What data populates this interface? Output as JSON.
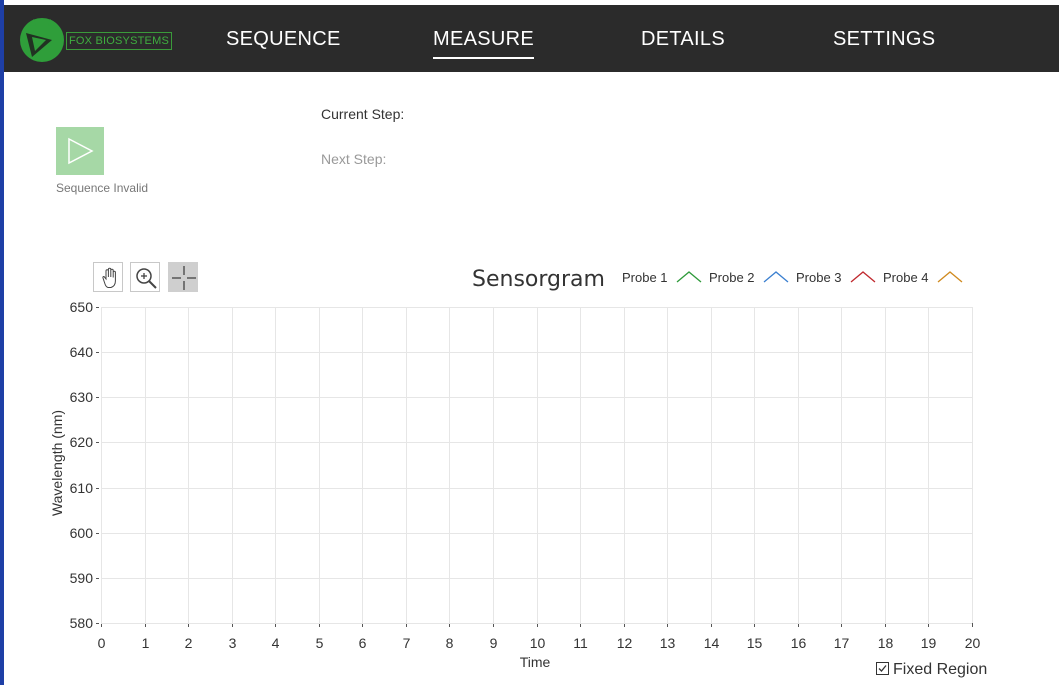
{
  "app": {
    "brand": "FOX BIOSYSTEMS"
  },
  "nav": {
    "tabs": [
      {
        "label": "SEQUENCE",
        "active": false
      },
      {
        "label": "MEASURE",
        "active": true
      },
      {
        "label": "DETAILS",
        "active": false
      },
      {
        "label": "SETTINGS",
        "active": false
      }
    ]
  },
  "controls": {
    "play_icon": "play-icon",
    "sequence_status": "Sequence Invalid",
    "current_step_label": "Current Step:",
    "next_step_label": "Next Step:"
  },
  "toolbar": {
    "tools": [
      {
        "name": "pan",
        "icon": "hand-icon",
        "active": false
      },
      {
        "name": "zoom",
        "icon": "zoom-in-icon",
        "active": false
      },
      {
        "name": "crosshair",
        "icon": "crosshair-icon",
        "active": true
      }
    ]
  },
  "fixed_region": {
    "label": "Fixed Region",
    "checked": true
  },
  "colors": {
    "nav_bg": "#2b2b2b",
    "brand_green": "#3fae3f",
    "play_button": "#a6d8a6",
    "probe1": "#2e9a3a",
    "probe2": "#3a7fd0",
    "probe3": "#c0282d",
    "probe4": "#d08a1e"
  },
  "chart_data": {
    "type": "line",
    "title": "Sensorgram",
    "xlabel": "Time",
    "ylabel": "Wavelength (nm)",
    "xlim": [
      0,
      20
    ],
    "ylim": [
      580,
      650
    ],
    "x_ticks": [
      "0",
      "1",
      "2",
      "3",
      "4",
      "5",
      "6",
      "7",
      "8",
      "9",
      "10",
      "11",
      "12",
      "13",
      "14",
      "15",
      "16",
      "17",
      "18",
      "19",
      "20"
    ],
    "y_ticks": [
      "650",
      "640",
      "630",
      "620",
      "610",
      "600",
      "590",
      "580"
    ],
    "grid": true,
    "legend_position": "top-right",
    "series": [
      {
        "name": "Probe 1",
        "color": "#2e9a3a",
        "values": []
      },
      {
        "name": "Probe 2",
        "color": "#3a7fd0",
        "values": []
      },
      {
        "name": "Probe 3",
        "color": "#c0282d",
        "values": []
      },
      {
        "name": "Probe 4",
        "color": "#d08a1e",
        "values": []
      }
    ]
  }
}
